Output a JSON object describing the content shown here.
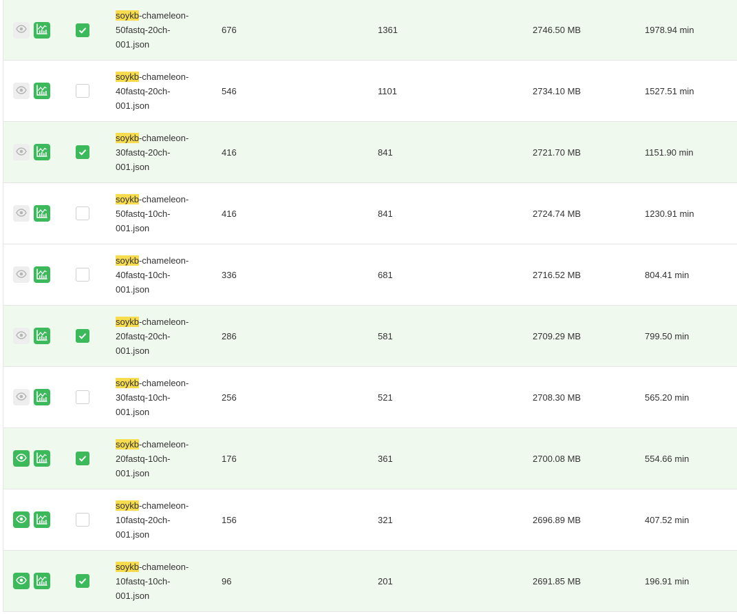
{
  "colors": {
    "accent": "#3cb95a",
    "selected_row_bg": "#f0f9ee",
    "highlight": "#f7dc4f",
    "eye_off_bg": "#eeeeee"
  },
  "icons": {
    "view": "eye-icon",
    "chart": "bar-chart-icon",
    "check": "checkmark-icon"
  },
  "search": {
    "highlight_term": "soykb"
  },
  "rows": [
    {
      "name_rest": "-chameleon-",
      "name_line2": "50fastq-20ch-",
      "name_line3": "001.json",
      "tasks": "676",
      "files": "1361",
      "size": "2746.50 MB",
      "time": "1978.94 min",
      "checked": true,
      "view_active": false
    },
    {
      "name_rest": "-chameleon-",
      "name_line2": "40fastq-20ch-",
      "name_line3": "001.json",
      "tasks": "546",
      "files": "1101",
      "size": "2734.10 MB",
      "time": "1527.51 min",
      "checked": false,
      "view_active": false
    },
    {
      "name_rest": "-chameleon-",
      "name_line2": "30fastq-20ch-",
      "name_line3": "001.json",
      "tasks": "416",
      "files": "841",
      "size": "2721.70 MB",
      "time": "1151.90 min",
      "checked": true,
      "view_active": false
    },
    {
      "name_rest": "-chameleon-",
      "name_line2": "50fastq-10ch-",
      "name_line3": "001.json",
      "tasks": "416",
      "files": "841",
      "size": "2724.74 MB",
      "time": "1230.91 min",
      "checked": false,
      "view_active": false
    },
    {
      "name_rest": "-chameleon-",
      "name_line2": "40fastq-10ch-",
      "name_line3": "001.json",
      "tasks": "336",
      "files": "681",
      "size": "2716.52 MB",
      "time": "804.41 min",
      "checked": false,
      "view_active": false
    },
    {
      "name_rest": "-chameleon-",
      "name_line2": "20fastq-20ch-",
      "name_line3": "001.json",
      "tasks": "286",
      "files": "581",
      "size": "2709.29 MB",
      "time": "799.50 min",
      "checked": true,
      "view_active": false
    },
    {
      "name_rest": "-chameleon-",
      "name_line2": "30fastq-10ch-",
      "name_line3": "001.json",
      "tasks": "256",
      "files": "521",
      "size": "2708.30 MB",
      "time": "565.20 min",
      "checked": false,
      "view_active": false
    },
    {
      "name_rest": "-chameleon-",
      "name_line2": "20fastq-10ch-",
      "name_line3": "001.json",
      "tasks": "176",
      "files": "361",
      "size": "2700.08 MB",
      "time": "554.66 min",
      "checked": true,
      "view_active": true
    },
    {
      "name_rest": "-chameleon-",
      "name_line2": "10fastq-20ch-",
      "name_line3": "001.json",
      "tasks": "156",
      "files": "321",
      "size": "2696.89 MB",
      "time": "407.52 min",
      "checked": false,
      "view_active": true
    },
    {
      "name_rest": "-chameleon-",
      "name_line2": "10fastq-10ch-",
      "name_line3": "001.json",
      "tasks": "96",
      "files": "201",
      "size": "2691.85 MB",
      "time": "196.91 min",
      "checked": true,
      "view_active": true
    }
  ]
}
